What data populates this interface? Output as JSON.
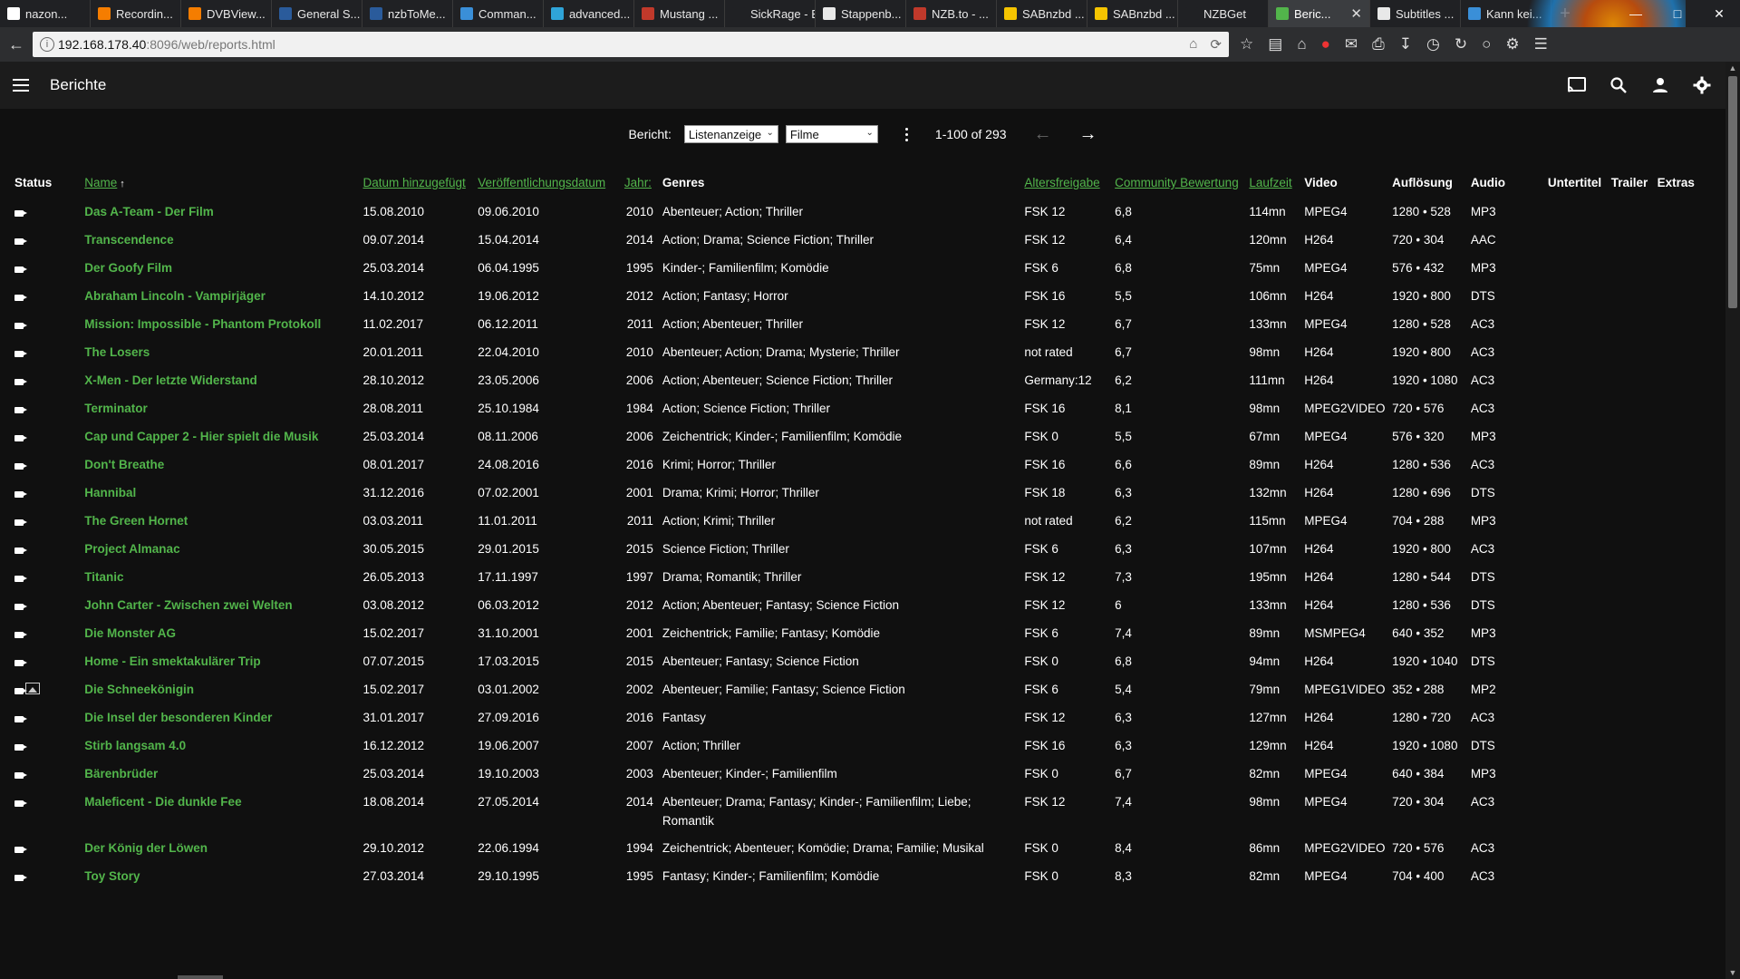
{
  "browser": {
    "tabs": [
      {
        "label": "nazon...",
        "color": "#ffffff"
      },
      {
        "label": "Recordin...",
        "color": "#f57d00"
      },
      {
        "label": "DVBView...",
        "color": "#f57d00"
      },
      {
        "label": "General S...",
        "color": "#2a5b9b"
      },
      {
        "label": "nzbToMe...",
        "color": "#2a5b9b"
      },
      {
        "label": "Comman...",
        "color": "#3a8fd8"
      },
      {
        "label": "advanced...",
        "color": "#2fa4d8"
      },
      {
        "label": "Mustang ...",
        "color": "#c0392b"
      },
      {
        "label": "SickRage - BR...",
        "color": "#202124"
      },
      {
        "label": "Stappenb...",
        "color": "#e8e8e8"
      },
      {
        "label": "NZB.to - ...",
        "color": "#c0392b"
      },
      {
        "label": "SABnzbd ...",
        "color": "#f5c400"
      },
      {
        "label": "SABnzbd ...",
        "color": "#f5c400"
      },
      {
        "label": "NZBGet",
        "color": "#202124"
      },
      {
        "label": "Beric...",
        "color": "#52b54b",
        "active": true
      },
      {
        "label": "Subtitles ...",
        "color": "#e8e8e8"
      },
      {
        "label": "Kann kei...",
        "color": "#3a8fd8"
      }
    ],
    "url_host": "192.168.178.40",
    "url_rest": ":8096/web/reports.html"
  },
  "header": {
    "title": "Berichte"
  },
  "controls": {
    "report_label": "Bericht:",
    "view_select": "Listenanzeige",
    "type_select": "Filme",
    "pager_text": "1-100 of 293"
  },
  "columns": {
    "status": "Status",
    "name": "Name",
    "sort_indicator": "↑",
    "date_added": "Datum hinzugefügt",
    "release_date": "Veröffentlichungsdatum",
    "year": "Jahr:",
    "genres": "Genres",
    "rating": "Altersfreigabe",
    "community": "Community Bewertung",
    "runtime": "Laufzeit",
    "video": "Video",
    "resolution": "Auflösung",
    "audio": "Audio",
    "subtitles": "Untertitel",
    "trailer": "Trailer",
    "extras": "Extras"
  },
  "rows": [
    {
      "name": "Das A-Team - Der Film",
      "added": "15.08.2010",
      "released": "09.06.2010",
      "year": "2010",
      "genres": "Abenteuer; Action; Thriller",
      "rating": "FSK 12",
      "community": "6,8",
      "runtime": "114mn",
      "video": "MPEG4",
      "resolution": "1280 • 528",
      "audio": "MP3"
    },
    {
      "name": "Transcendence",
      "added": "09.07.2014",
      "released": "15.04.2014",
      "year": "2014",
      "genres": "Action; Drama; Science Fiction; Thriller",
      "rating": "FSK 12",
      "community": "6,4",
      "runtime": "120mn",
      "video": "H264",
      "resolution": "720 • 304",
      "audio": "AAC"
    },
    {
      "name": "Der Goofy Film",
      "added": "25.03.2014",
      "released": "06.04.1995",
      "year": "1995",
      "genres": "Kinder-; Familienfilm; Komödie",
      "rating": "FSK 6",
      "community": "6,8",
      "runtime": "75mn",
      "video": "MPEG4",
      "resolution": "576 • 432",
      "audio": "MP3"
    },
    {
      "name": "Abraham Lincoln - Vampirjäger",
      "added": "14.10.2012",
      "released": "19.06.2012",
      "year": "2012",
      "genres": "Action; Fantasy; Horror",
      "rating": "FSK 16",
      "community": "5,5",
      "runtime": "106mn",
      "video": "H264",
      "resolution": "1920 • 800",
      "audio": "DTS"
    },
    {
      "name": "Mission: Impossible - Phantom Protokoll",
      "added": "11.02.2017",
      "released": "06.12.2011",
      "year": "2011",
      "genres": "Action; Abenteuer; Thriller",
      "rating": "FSK 12",
      "community": "6,7",
      "runtime": "133mn",
      "video": "MPEG4",
      "resolution": "1280 • 528",
      "audio": "AC3"
    },
    {
      "name": "The Losers",
      "added": "20.01.2011",
      "released": "22.04.2010",
      "year": "2010",
      "genres": "Abenteuer; Action; Drama; Mysterie; Thriller",
      "rating": "not rated",
      "community": "6,7",
      "runtime": "98mn",
      "video": "H264",
      "resolution": "1920 • 800",
      "audio": "AC3"
    },
    {
      "name": "X-Men - Der letzte Widerstand",
      "added": "28.10.2012",
      "released": "23.05.2006",
      "year": "2006",
      "genres": "Action; Abenteuer; Science Fiction; Thriller",
      "rating": "Germany:12",
      "community": "6,2",
      "runtime": "111mn",
      "video": "H264",
      "resolution": "1920 • 1080",
      "audio": "AC3"
    },
    {
      "name": "Terminator",
      "added": "28.08.2011",
      "released": "25.10.1984",
      "year": "1984",
      "genres": "Action; Science Fiction; Thriller",
      "rating": "FSK 16",
      "community": "8,1",
      "runtime": "98mn",
      "video": "MPEG2VIDEO",
      "resolution": "720 • 576",
      "audio": "AC3"
    },
    {
      "name": "Cap und Capper 2 - Hier spielt die Musik",
      "added": "25.03.2014",
      "released": "08.11.2006",
      "year": "2006",
      "genres": "Zeichentrick; Kinder-; Familienfilm; Komödie",
      "rating": "FSK 0",
      "community": "5,5",
      "runtime": "67mn",
      "video": "MPEG4",
      "resolution": "576 • 320",
      "audio": "MP3"
    },
    {
      "name": "Don't Breathe",
      "added": "08.01.2017",
      "released": "24.08.2016",
      "year": "2016",
      "genres": "Krimi; Horror; Thriller",
      "rating": "FSK 16",
      "community": "6,6",
      "runtime": "89mn",
      "video": "H264",
      "resolution": "1280 • 536",
      "audio": "AC3"
    },
    {
      "name": "Hannibal",
      "added": "31.12.2016",
      "released": "07.02.2001",
      "year": "2001",
      "genres": "Drama; Krimi; Horror; Thriller",
      "rating": "FSK 18",
      "community": "6,3",
      "runtime": "132mn",
      "video": "H264",
      "resolution": "1280 • 696",
      "audio": "DTS"
    },
    {
      "name": "The Green Hornet",
      "added": "03.03.2011",
      "released": "11.01.2011",
      "year": "2011",
      "genres": "Action; Krimi; Thriller",
      "rating": "not rated",
      "community": "6,2",
      "runtime": "115mn",
      "video": "MPEG4",
      "resolution": "704 • 288",
      "audio": "MP3"
    },
    {
      "name": "Project Almanac",
      "added": "30.05.2015",
      "released": "29.01.2015",
      "year": "2015",
      "genres": "Science Fiction; Thriller",
      "rating": "FSK 6",
      "community": "6,3",
      "runtime": "107mn",
      "video": "H264",
      "resolution": "1920 • 800",
      "audio": "AC3"
    },
    {
      "name": "Titanic",
      "added": "26.05.2013",
      "released": "17.11.1997",
      "year": "1997",
      "genres": "Drama; Romantik; Thriller",
      "rating": "FSK 12",
      "community": "7,3",
      "runtime": "195mn",
      "video": "H264",
      "resolution": "1280 • 544",
      "audio": "DTS"
    },
    {
      "name": "John Carter - Zwischen zwei Welten",
      "added": "03.08.2012",
      "released": "06.03.2012",
      "year": "2012",
      "genres": "Action; Abenteuer; Fantasy; Science Fiction",
      "rating": "FSK 12",
      "community": "6",
      "runtime": "133mn",
      "video": "H264",
      "resolution": "1280 • 536",
      "audio": "DTS"
    },
    {
      "name": "Die Monster AG",
      "added": "15.02.2017",
      "released": "31.10.2001",
      "year": "2001",
      "genres": "Zeichentrick; Familie; Fantasy; Komödie",
      "rating": "FSK 6",
      "community": "7,4",
      "runtime": "89mn",
      "video": "MSMPEG4",
      "resolution": "640 • 352",
      "audio": "MP3"
    },
    {
      "name": "Home - Ein smektakulärer Trip",
      "added": "07.07.2015",
      "released": "17.03.2015",
      "year": "2015",
      "genres": "Abenteuer; Fantasy; Science Fiction",
      "rating": "FSK 0",
      "community": "6,8",
      "runtime": "94mn",
      "video": "H264",
      "resolution": "1920 • 1040",
      "audio": "DTS"
    },
    {
      "name": "Die Schneekönigin",
      "added": "15.02.2017",
      "released": "03.01.2002",
      "year": "2002",
      "genres": "Abenteuer; Familie; Fantasy; Science Fiction",
      "rating": "FSK 6",
      "community": "5,4",
      "runtime": "79mn",
      "video": "MPEG1VIDEO",
      "resolution": "352 • 288",
      "audio": "MP2",
      "image_icon": true
    },
    {
      "name": "Die Insel der besonderen Kinder",
      "added": "31.01.2017",
      "released": "27.09.2016",
      "year": "2016",
      "genres": "Fantasy",
      "rating": "FSK 12",
      "community": "6,3",
      "runtime": "127mn",
      "video": "H264",
      "resolution": "1280 • 720",
      "audio": "AC3"
    },
    {
      "name": "Stirb langsam 4.0",
      "added": "16.12.2012",
      "released": "19.06.2007",
      "year": "2007",
      "genres": "Action; Thriller",
      "rating": "FSK 16",
      "community": "6,3",
      "runtime": "129mn",
      "video": "H264",
      "resolution": "1920 • 1080",
      "audio": "DTS"
    },
    {
      "name": "Bärenbrüder",
      "added": "25.03.2014",
      "released": "19.10.2003",
      "year": "2003",
      "genres": "Abenteuer; Kinder-; Familienfilm",
      "rating": "FSK 0",
      "community": "6,7",
      "runtime": "82mn",
      "video": "MPEG4",
      "resolution": "640 • 384",
      "audio": "MP3"
    },
    {
      "name": "Maleficent - Die dunkle Fee",
      "added": "18.08.2014",
      "released": "27.05.2014",
      "year": "2014",
      "genres": "Abenteuer; Drama; Fantasy; Kinder-; Familienfilm; Liebe; Romantik",
      "rating": "FSK 12",
      "community": "7,4",
      "runtime": "98mn",
      "video": "MPEG4",
      "resolution": "720 • 304",
      "audio": "AC3"
    },
    {
      "name": "Der König der Löwen",
      "added": "29.10.2012",
      "released": "22.06.1994",
      "year": "1994",
      "genres": "Zeichentrick; Abenteuer; Komödie; Drama; Familie; Musikal",
      "rating": "FSK 0",
      "community": "8,4",
      "runtime": "86mn",
      "video": "MPEG2VIDEO",
      "resolution": "720 • 576",
      "audio": "AC3"
    },
    {
      "name": "Toy Story",
      "added": "27.03.2014",
      "released": "29.10.1995",
      "year": "1995",
      "genres": "Fantasy; Kinder-; Familienfilm; Komödie",
      "rating": "FSK 0",
      "community": "8,3",
      "runtime": "82mn",
      "video": "MPEG4",
      "resolution": "704 • 400",
      "audio": "AC3"
    }
  ],
  "colors": {
    "accent": "#52b54b",
    "background": "#101010",
    "header": "#1c1c1c"
  }
}
